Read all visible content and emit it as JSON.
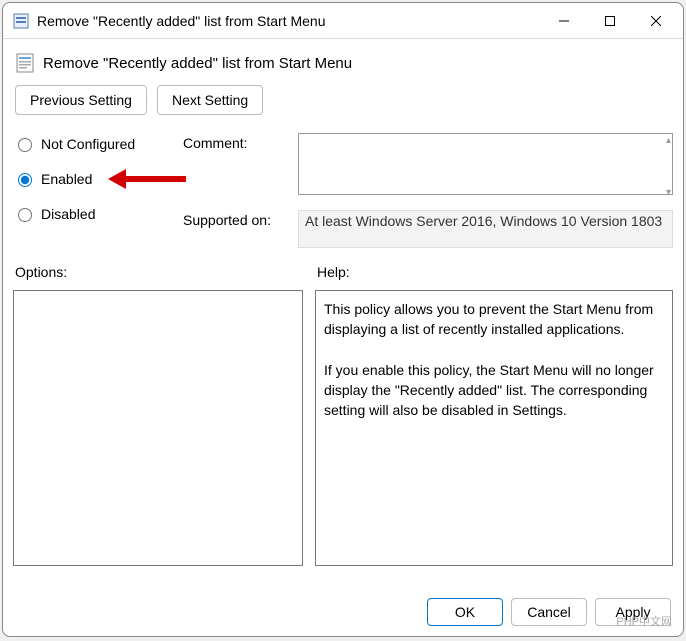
{
  "window": {
    "title": "Remove \"Recently added\" list from Start Menu"
  },
  "policy": {
    "title": "Remove \"Recently added\" list from Start Menu"
  },
  "nav": {
    "previous": "Previous Setting",
    "next": "Next Setting"
  },
  "radios": {
    "not_configured": "Not Configured",
    "enabled": "Enabled",
    "disabled": "Disabled",
    "selected": "enabled"
  },
  "labels": {
    "comment": "Comment:",
    "supported": "Supported on:",
    "options": "Options:",
    "help": "Help:"
  },
  "comment": "",
  "supported": "At least Windows Server 2016, Windows 10 Version 1803",
  "help_text": "This policy allows you to prevent the Start Menu from displaying a list of recently installed applications.\n\nIf you enable this policy, the Start Menu will no longer display the \"Recently added\" list. The corresponding setting will also be disabled in Settings.",
  "footer": {
    "ok": "OK",
    "cancel": "Cancel",
    "apply": "Apply"
  },
  "watermark": "PHP中文网"
}
